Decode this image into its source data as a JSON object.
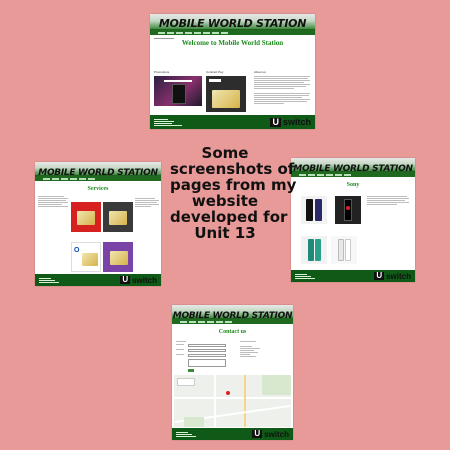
{
  "caption": {
    "lines": [
      "Some",
      "screenshots of",
      "pages from my",
      "website",
      "developed for",
      "Unit 13"
    ]
  },
  "site": {
    "brand": "MOBILE WORLD STATION",
    "footer_logo_letter": "U",
    "footer_logo_word": "switch"
  },
  "screens": {
    "home": {
      "title": "Welcome to Mobile World Station",
      "columns": [
        "Promotions",
        "Contract Pay",
        "About us"
      ]
    },
    "services": {
      "title": "Services"
    },
    "sony": {
      "title": "Sony"
    },
    "contact": {
      "title": "Contact us"
    }
  },
  "colors": {
    "background": "#e89a98",
    "site_green": "#1d8a1d",
    "footer_green": "#0f5a16"
  }
}
